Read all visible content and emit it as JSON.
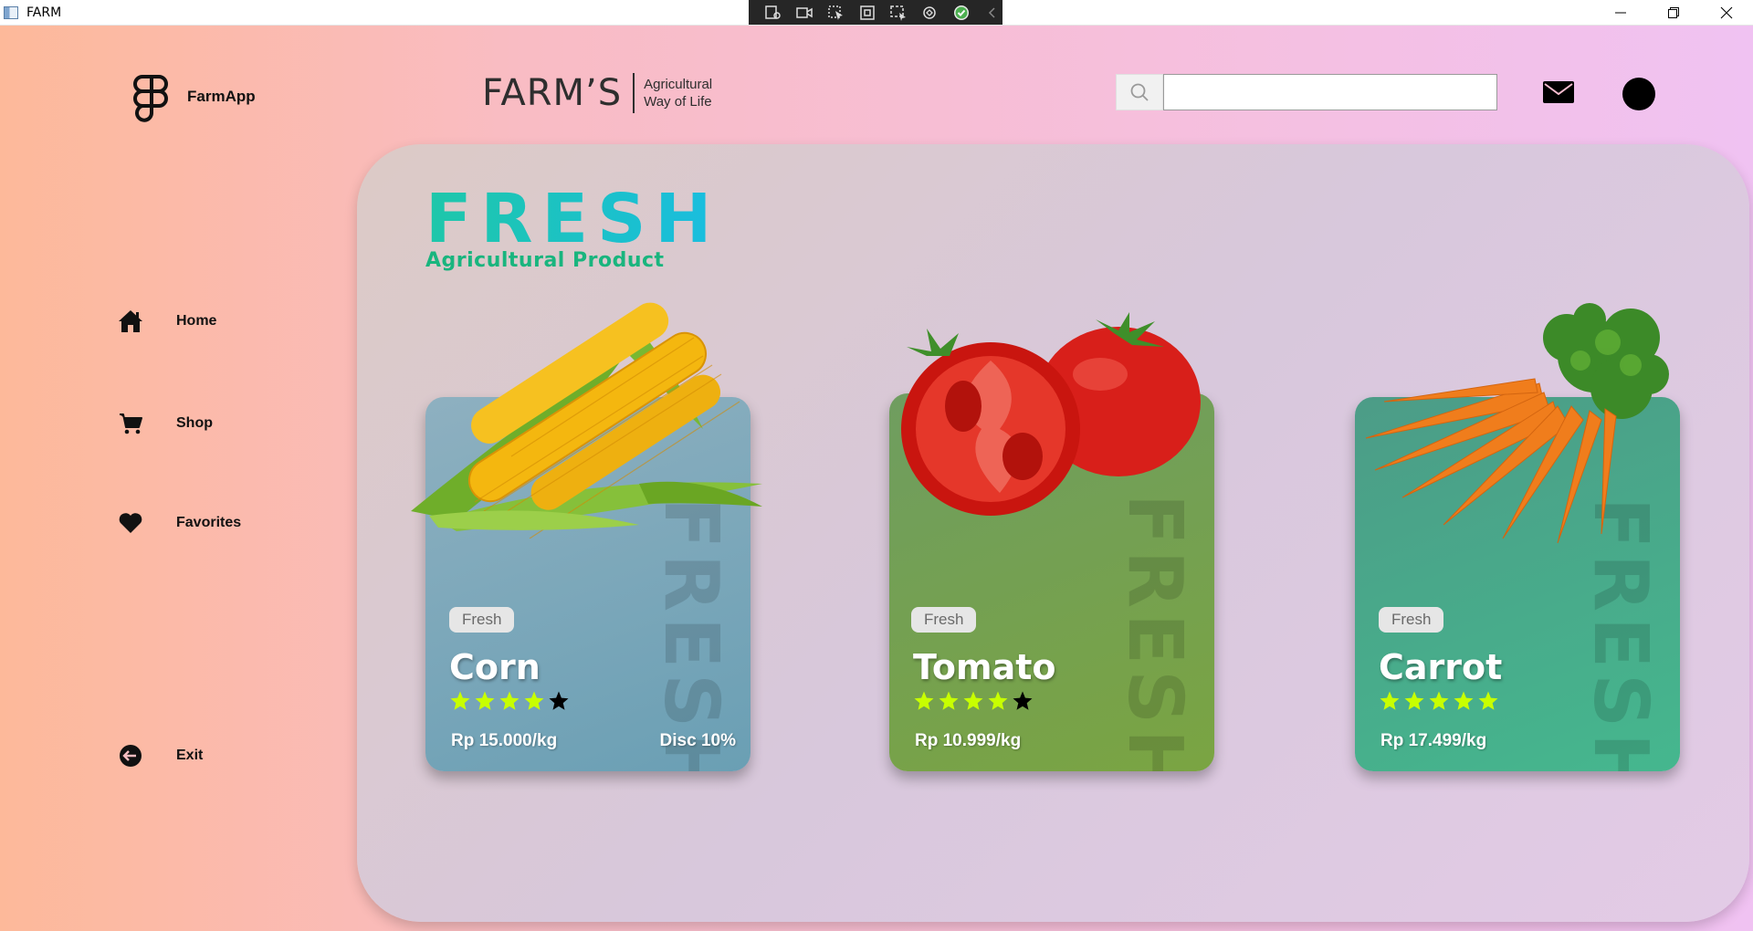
{
  "window": {
    "title": "FARM"
  },
  "header": {
    "logo_text": "FarmApp",
    "brand_name": "FARM’S",
    "brand_tagline_1": "Agricultural",
    "brand_tagline_2": "Way of Life",
    "search": {
      "value": "",
      "placeholder": ""
    }
  },
  "sidebar": {
    "items": [
      {
        "label": "Home",
        "icon": "home-icon"
      },
      {
        "label": "Shop",
        "icon": "cart-icon"
      },
      {
        "label": "Favorites",
        "icon": "heart-icon"
      }
    ],
    "exit_label": "Exit"
  },
  "hero": {
    "title": "FRESH",
    "subtitle": "Agricultural Product"
  },
  "products": [
    {
      "badge": "Fresh",
      "name": "Corn",
      "rating": 4,
      "max_rating": 5,
      "price": "Rp 15.000/kg",
      "discount": "Disc 10%",
      "watermark": "FRESH"
    },
    {
      "badge": "Fresh",
      "name": "Tomato",
      "rating": 4,
      "max_rating": 5,
      "price": "Rp 10.999/kg",
      "discount": "",
      "watermark": "FRESH"
    },
    {
      "badge": "Fresh",
      "name": "Carrot",
      "rating": 5,
      "max_rating": 5,
      "price": "Rp 17.499/kg",
      "discount": "",
      "watermark": "FRESH"
    }
  ],
  "colors": {
    "star_filled": "#c8ff00",
    "star_empty": "#000000",
    "hero_title": "#19bde0",
    "hero_subtitle": "#19b57e"
  }
}
